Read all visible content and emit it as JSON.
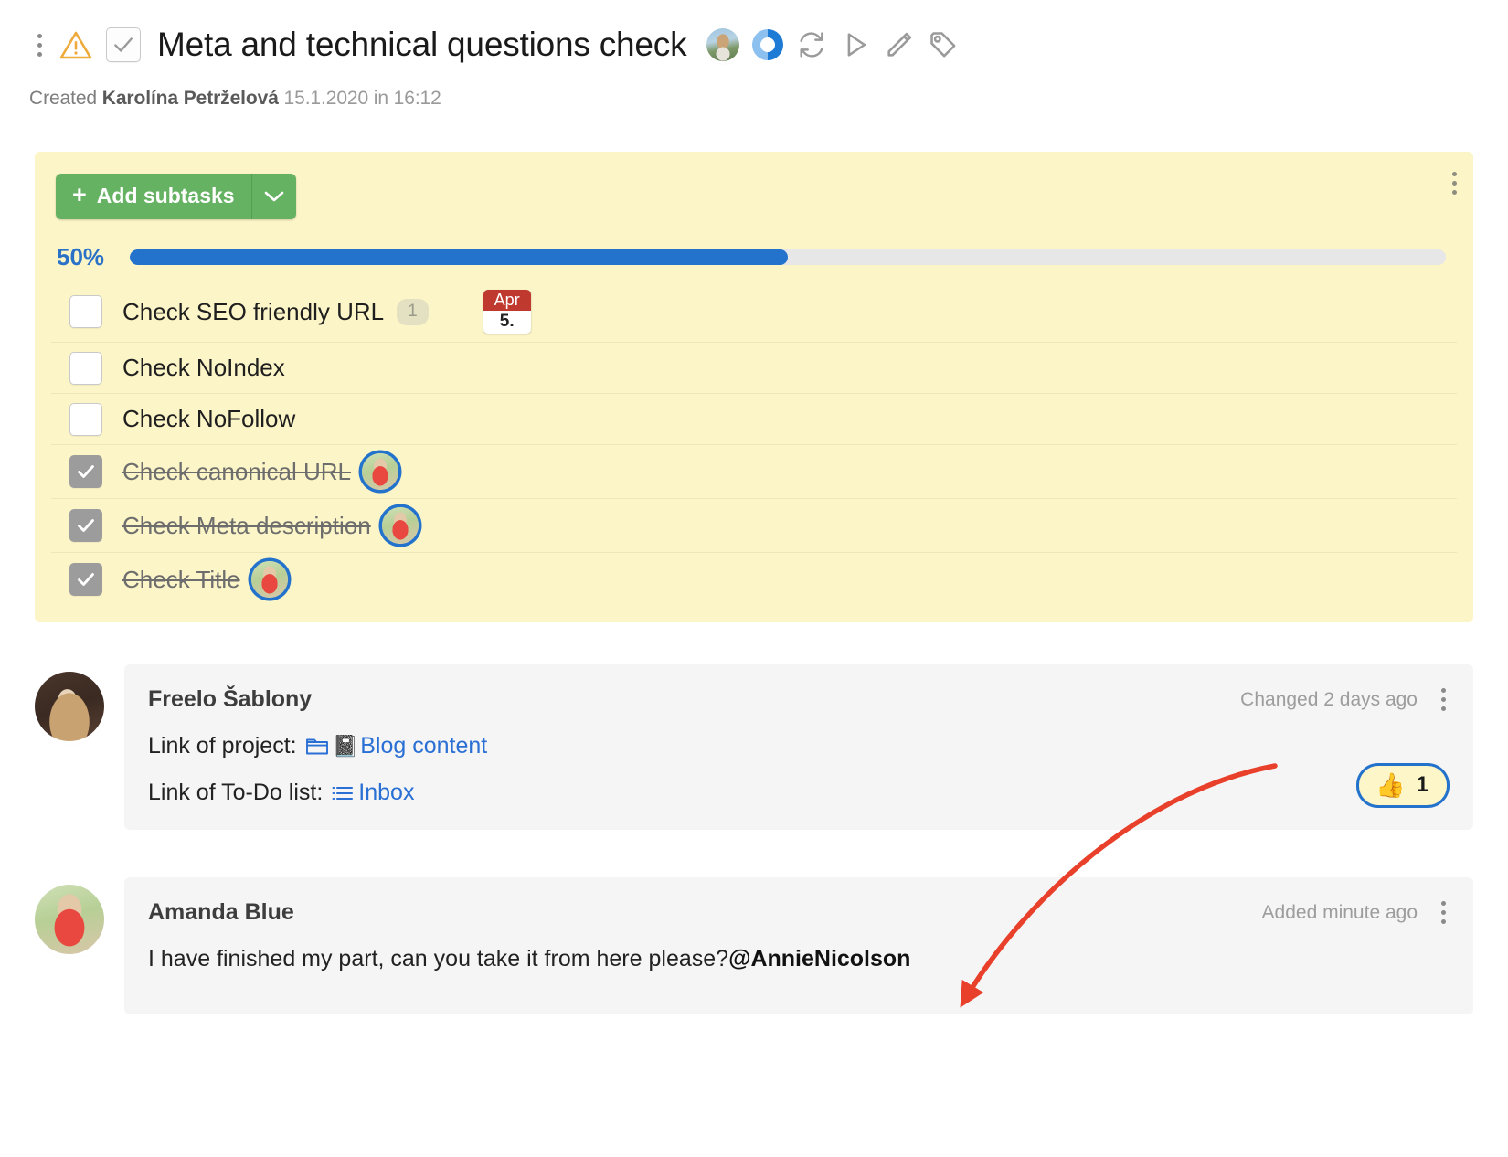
{
  "header": {
    "title": "Meta and technical questions check",
    "created_prefix": "Created",
    "created_author": "Karolína Petrželová",
    "created_date": "15.1.2020 in 16:12",
    "icons": {
      "kebab": "more-vertical-icon",
      "warning": "warning-triangle-icon",
      "checkbox": "task-checkbox-icon",
      "avatar": "assignee-avatar",
      "progress": "progress-donut-icon",
      "repeat": "repeat-icon",
      "play": "play-icon",
      "edit": "pencil-icon",
      "tag": "tag-icon"
    }
  },
  "subtasks_panel": {
    "add_button_label": "Add subtasks",
    "add_button_plus": "+",
    "progress_percent_label": "50%",
    "progress_percent_value": 50,
    "items": [
      {
        "label": "Check SEO friendly URL",
        "done": false,
        "count_badge": "1",
        "date_month": "Apr",
        "date_day": "5.",
        "has_avatar": false
      },
      {
        "label": "Check NoIndex",
        "done": false,
        "count_badge": null,
        "date_month": null,
        "date_day": null,
        "has_avatar": false
      },
      {
        "label": "Check NoFollow",
        "done": false,
        "count_badge": null,
        "date_month": null,
        "date_day": null,
        "has_avatar": false
      },
      {
        "label": "Check canonical URL",
        "done": true,
        "count_badge": null,
        "date_month": null,
        "date_day": null,
        "has_avatar": true
      },
      {
        "label": "Check Meta description",
        "done": true,
        "count_badge": null,
        "date_month": null,
        "date_day": null,
        "has_avatar": true
      },
      {
        "label": "Check Title",
        "done": true,
        "count_badge": null,
        "date_month": null,
        "date_day": null,
        "has_avatar": true
      }
    ]
  },
  "comments": [
    {
      "author": "Freelo Šablony",
      "timestamp": "Changed 2 days ago",
      "line1_label": "Link of project:",
      "line1_link": "Blog content",
      "line2_label": "Link of To-Do list:",
      "line2_link": "Inbox",
      "reaction_emoji": "👍",
      "reaction_count": "1"
    },
    {
      "author": "Amanda Blue",
      "timestamp": "Added minute ago",
      "text": "I have finished my part, can you take it from here please? ",
      "mention": "@AnnieNicolson"
    }
  ],
  "colors": {
    "panel_bg": "#fcf5c7",
    "progress_blue": "#2372cb",
    "add_button_green": "#66b263",
    "link_blue": "#2a6fd4",
    "date_red": "#c0392f",
    "annotation_red": "#e8402a"
  }
}
